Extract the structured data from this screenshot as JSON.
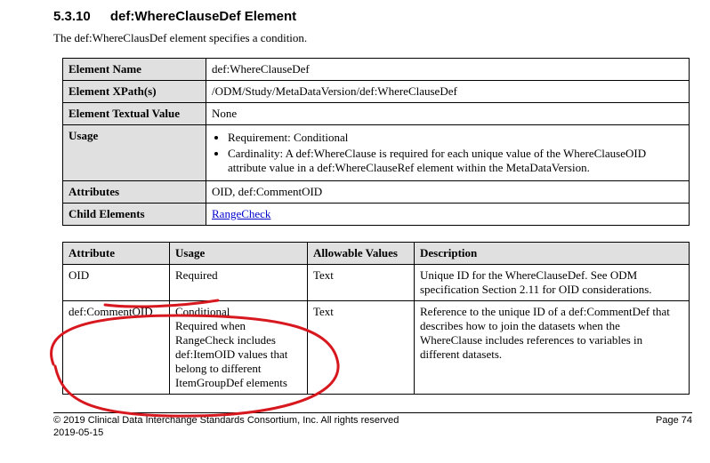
{
  "heading": {
    "number": "5.3.10",
    "title": "def:WhereClauseDef Element"
  },
  "intro": "The def:WhereClausDef element specifies a condition.",
  "spec": {
    "elementName": {
      "label": "Element Name",
      "value": "def:WhereClauseDef"
    },
    "xpath": {
      "label": "Element XPath(s)",
      "value": "/ODM/Study/MetaDataVersion/def:WhereClauseDef"
    },
    "textual": {
      "label": "Element Textual Value",
      "value": "None"
    },
    "usage": {
      "label": "Usage",
      "items": [
        "Requirement: Conditional",
        "Cardinality: A def:WhereClause is required for each unique value of the WhereClauseOID attribute value in a def:WhereClauseRef element within the MetaDataVersion."
      ]
    },
    "attributes": {
      "label": "Attributes",
      "value": "OID, def:CommentOID"
    },
    "children": {
      "label": "Child Elements",
      "link": "RangeCheck"
    }
  },
  "attrTable": {
    "headers": {
      "attr": "Attribute",
      "usage": "Usage",
      "allow": "Allowable Values",
      "desc": "Description"
    },
    "rows": [
      {
        "attr": "OID",
        "usage": "Required",
        "allow": "Text",
        "desc": "Unique ID for the WhereClauseDef. See ODM specification Section 2.11 for OID considerations."
      },
      {
        "attr": "def:CommentOID",
        "usage": "Conditional\nRequired when RangeCheck includes def:ItemOID values that belong to different ItemGroupDef elements",
        "allow": "Text",
        "desc": "Reference to the unique ID of a def:CommentDef that describes how to join the datasets when the WhereClause includes references to variables in different datasets."
      }
    ]
  },
  "footer": {
    "copyright": "© 2019 Clinical Data Interchange Standards Consortium, Inc. All rights reserved",
    "page": "Page 74",
    "date": "2019-05-15"
  }
}
